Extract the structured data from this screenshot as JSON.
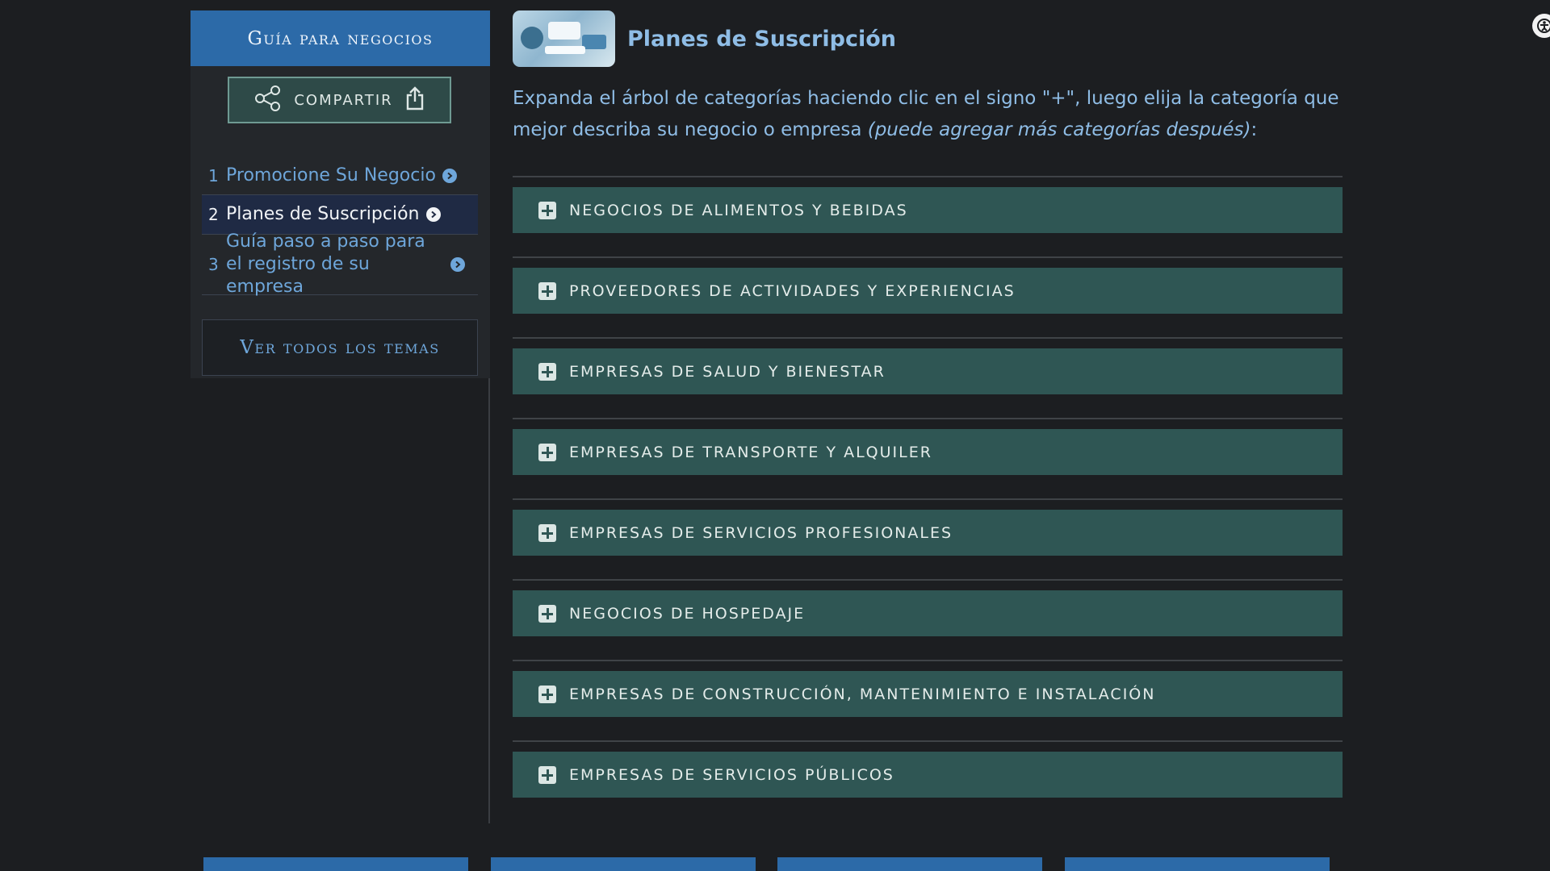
{
  "sidebar": {
    "header": "Guía para negocios",
    "share_label": "COMPARTIR",
    "items": [
      {
        "num": "1",
        "label": "Promocione Su Negocio"
      },
      {
        "num": "2",
        "label": "Planes de Suscripción"
      },
      {
        "num": "3",
        "label": "Guía paso a paso para el registro de su empresa"
      }
    ],
    "all_topics": "Ver todos los temas"
  },
  "main": {
    "title": "Planes de Suscripción",
    "intro_text": "Expanda el árbol de categorías haciendo clic en el signo \"+\", luego elija la categoría que mejor describa su negocio o empresa ",
    "intro_em": "(puede agregar más categorías después)",
    "intro_end": ":",
    "categories": [
      "NEGOCIOS DE ALIMENTOS Y BEBIDAS",
      "PROVEEDORES DE ACTIVIDADES Y EXPERIENCIAS",
      "EMPRESAS DE SALUD Y BIENESTAR",
      "EMPRESAS DE TRANSPORTE Y ALQUILER",
      "EMPRESAS DE SERVICIOS PROFESIONALES",
      "NEGOCIOS DE HOSPEDAJE",
      "EMPRESAS DE CONSTRUCCIÓN, MANTENIMIENTO E INSTALACIÓN",
      "EMPRESAS DE SERVICIOS PÚBLICOS"
    ]
  },
  "colors": {
    "background": "#1c1e21",
    "header_blue": "#2c6aa8",
    "link_blue": "#6ea6da",
    "accordion_teal": "#2f5654"
  }
}
